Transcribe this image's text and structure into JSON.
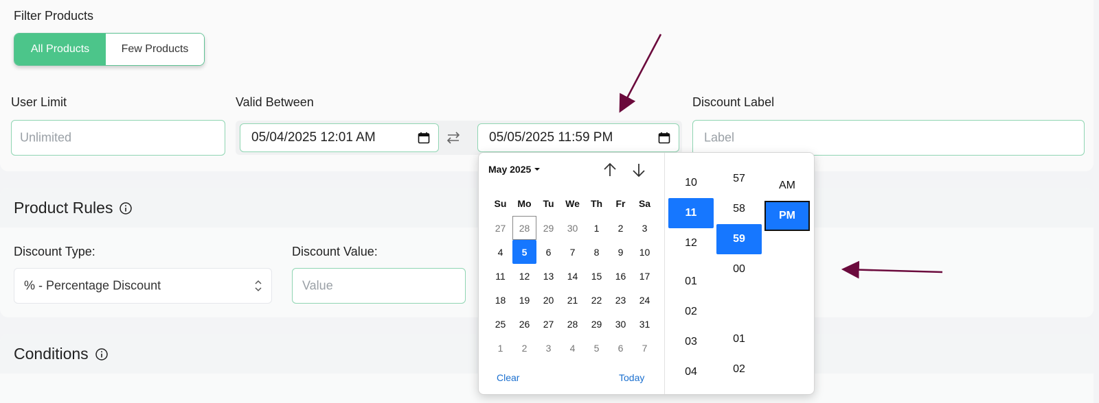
{
  "filter": {
    "title": "Filter Products",
    "options": [
      {
        "label": "All Products",
        "selected": true
      },
      {
        "label": "Few Products",
        "selected": false
      }
    ]
  },
  "user_limit": {
    "label": "User Limit",
    "placeholder": "Unlimited"
  },
  "valid_between": {
    "label": "Valid Between",
    "start": "05/04/2025 12:01 AM",
    "end": "05/05/2025 11:59 PM"
  },
  "discount_label": {
    "label": "Discount Label",
    "placeholder": "Label"
  },
  "product_rules": {
    "title": "Product Rules"
  },
  "discount_type": {
    "label": "Discount Type:",
    "value": "% - Percentage Discount"
  },
  "discount_value": {
    "label": "Discount Value:",
    "placeholder": "Value"
  },
  "conditions": {
    "title": "Conditions"
  },
  "picker": {
    "month_label": "May 2025",
    "weekdays": [
      "Su",
      "Mo",
      "Tu",
      "We",
      "Th",
      "Fr",
      "Sa"
    ],
    "weeks": [
      [
        {
          "d": "27",
          "m": true
        },
        {
          "d": "28",
          "m": true,
          "today": true
        },
        {
          "d": "29",
          "m": true
        },
        {
          "d": "30",
          "m": true
        },
        {
          "d": "1"
        },
        {
          "d": "2"
        },
        {
          "d": "3"
        }
      ],
      [
        {
          "d": "4"
        },
        {
          "d": "5",
          "sel": true
        },
        {
          "d": "6"
        },
        {
          "d": "7"
        },
        {
          "d": "8"
        },
        {
          "d": "9"
        },
        {
          "d": "10"
        }
      ],
      [
        {
          "d": "11"
        },
        {
          "d": "12"
        },
        {
          "d": "13"
        },
        {
          "d": "14"
        },
        {
          "d": "15"
        },
        {
          "d": "16"
        },
        {
          "d": "17"
        }
      ],
      [
        {
          "d": "18"
        },
        {
          "d": "19"
        },
        {
          "d": "20"
        },
        {
          "d": "21"
        },
        {
          "d": "22"
        },
        {
          "d": "23"
        },
        {
          "d": "24"
        }
      ],
      [
        {
          "d": "25"
        },
        {
          "d": "26"
        },
        {
          "d": "27"
        },
        {
          "d": "28"
        },
        {
          "d": "29"
        },
        {
          "d": "30"
        },
        {
          "d": "31"
        }
      ],
      [
        {
          "d": "1",
          "m": true
        },
        {
          "d": "2",
          "m": true
        },
        {
          "d": "3",
          "m": true
        },
        {
          "d": "4",
          "m": true
        },
        {
          "d": "5",
          "m": true
        },
        {
          "d": "6",
          "m": true
        },
        {
          "d": "7",
          "m": true
        }
      ]
    ],
    "clear_label": "Clear",
    "today_label": "Today",
    "hours": [
      "10",
      "11",
      "12",
      "01",
      "02",
      "03",
      "04"
    ],
    "selected_hour": "11",
    "minutes": [
      "57",
      "58",
      "59",
      "00",
      "01",
      "02"
    ],
    "selected_minute": "59",
    "periods": [
      "AM",
      "PM"
    ],
    "selected_period": "PM"
  },
  "colors": {
    "accent_green": "#4cc58a",
    "selection_blue": "#1677ff",
    "annotation_arrow": "#6b0a3c"
  }
}
